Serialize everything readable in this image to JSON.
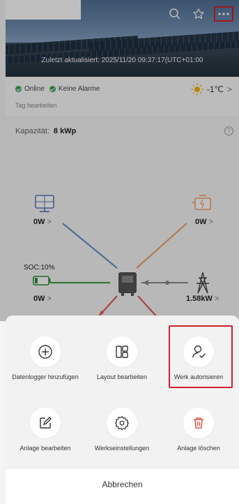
{
  "header": {
    "updated_text": "Zuletzt aktualisiert: 2025/11/20 09:37:17(UTC+01:00",
    "icons": [
      "search-icon",
      "star-icon",
      "more-icon"
    ]
  },
  "status": {
    "online": "Online",
    "alarms": "Keine Alarme",
    "edit_tags": "Tag bearbeiten",
    "temperature": "-1℃",
    "chevron": ">"
  },
  "overview": {
    "capacity_label": "Kapazität:",
    "capacity_value": "8 kWp",
    "help": "?",
    "pv_value": "0W",
    "generator_value": "0W",
    "soc_label": "SOC:10%",
    "battery_value": "0W",
    "grid_value": "1.58kW",
    "gt": ">"
  },
  "sheet": {
    "actions": [
      {
        "label": "Datenlogger hinzufügen",
        "icon": "plus-circle-icon"
      },
      {
        "label": "Layout bearbeiten",
        "icon": "layout-icon"
      },
      {
        "label": "Werk autorisieren",
        "icon": "authorize-user-icon"
      },
      {
        "label": "Anlage bearbeiten",
        "icon": "edit-icon"
      },
      {
        "label": "Werkseinstellungen",
        "icon": "gear-icon"
      },
      {
        "label": "Anlage löschen",
        "icon": "trash-icon"
      }
    ],
    "cancel": "Abbrechen"
  },
  "colors": {
    "accent_red": "#d21f2a",
    "online_green": "#3aa657",
    "pv_line": "#6f90c9",
    "gen_line": "#f0a36d",
    "battery_line": "#46a24a",
    "grid_line": "#8a8a8a",
    "load_line": "#e15b5b"
  }
}
